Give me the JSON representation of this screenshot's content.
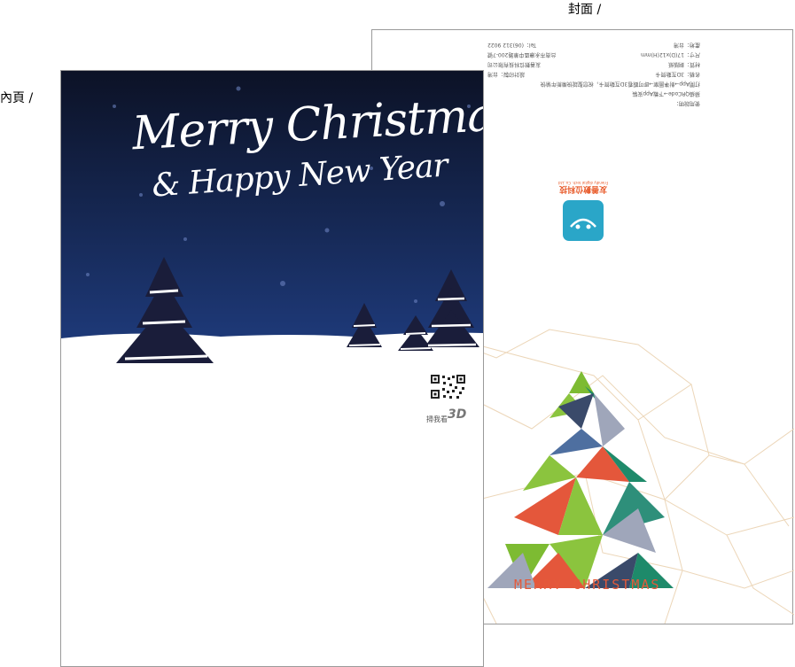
{
  "labels": {
    "cover": "封面 /",
    "inner": "內頁 /"
  },
  "cover": {
    "info_lines": [
      {
        "left": "使用說明：",
        "right": ""
      },
      {
        "left": "掃描QRCode→下載App安裝",
        "right": ""
      },
      {
        "left": "打開App→對準圖案→即可觀看3D互動賀卡，祝您聖誕快樂新年愉快",
        "right": ""
      },
      {
        "left": "名稱：3D互動賀卡",
        "right": "設計印製：台灣"
      },
      {
        "left": "材質：銅版紙",
        "right": "友善數位科技有限公司"
      },
      {
        "left": "尺寸：17(D)x12(H)mm",
        "right": "台南市永康區中華路200-7號"
      },
      {
        "left": "產地：台灣",
        "right": "Tel：(06)312 9022"
      }
    ],
    "logo_text": "友善數位科技",
    "logo_subtext": "Friendly digital tech. Co.,Ltd",
    "merry_text": "MERRY CHRISTMAS",
    "colors": {
      "logo": "#2aa6c8",
      "merry": "#e45a3a"
    }
  },
  "inner": {
    "greeting_line1": "Merry Christmas",
    "greeting_line2": "& Happy New Year",
    "qr_caption": "掃我看",
    "qr_3d": "3D",
    "colors": {
      "sky_top": "#0c1226",
      "sky_bottom": "#1e3a7a",
      "snow": "#ffffff"
    }
  }
}
